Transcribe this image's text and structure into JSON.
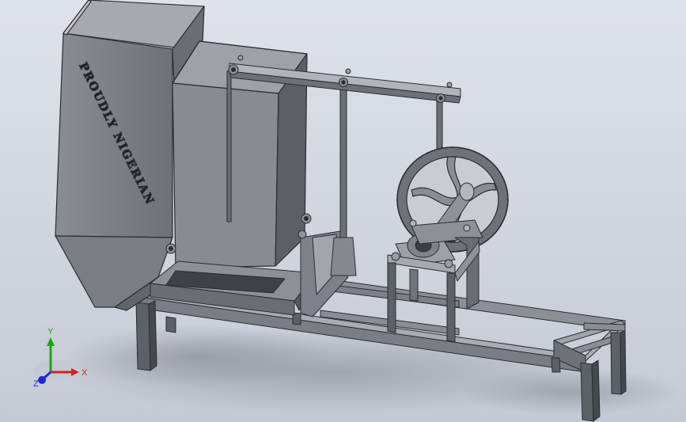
{
  "window": {
    "title": ""
  },
  "model": {
    "name": "",
    "engraving": "PROUDLY NIGERIAN",
    "colors": {
      "metal_light": "#9a9da4",
      "metal_mid": "#7d8088",
      "metal_dark": "#4f5259",
      "edge": "#2b2d31",
      "shadow": "#8f949c"
    }
  },
  "triad": {
    "x_label": "X",
    "y_label": "Y",
    "z_label": "Z",
    "x_color": "#d42222",
    "y_color": "#1aa51a",
    "z_color": "#1c2bd6"
  },
  "icons": [
    "triad-icon",
    "axis-x-arrow",
    "axis-y-arrow",
    "axis-z-arrow"
  ]
}
